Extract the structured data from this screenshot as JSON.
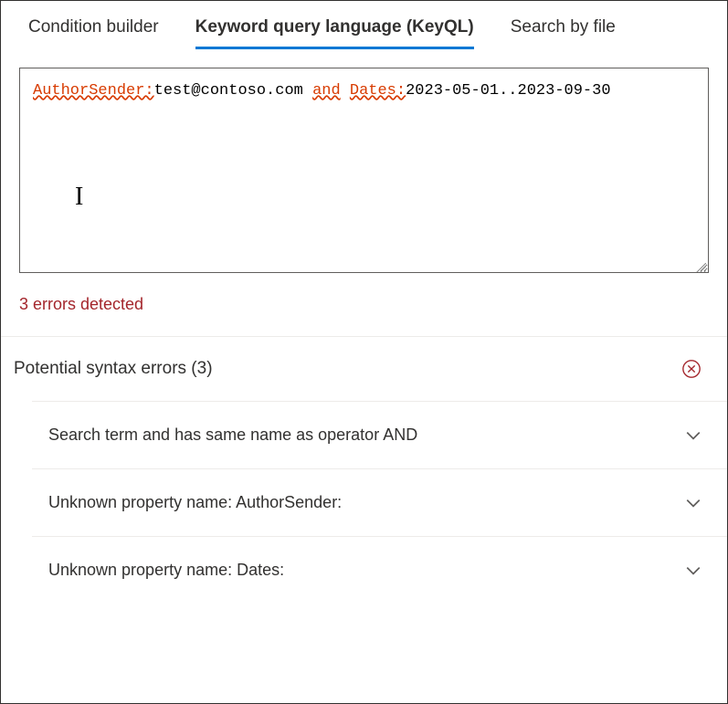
{
  "tabs": {
    "condition_builder": "Condition builder",
    "keyql": "Keyword query language (KeyQL)",
    "search_by_file": "Search by file"
  },
  "query": {
    "prop1": "AuthorSender:",
    "val1": "test@contoso.com",
    "op": "and",
    "prop2": "Dates:",
    "val2": "2023-05-01..2023-09-30"
  },
  "error_summary": "3 errors detected",
  "section": {
    "title": "Potential syntax errors (3)"
  },
  "errors": [
    {
      "message": "Search term and has same name as operator AND"
    },
    {
      "message": "Unknown property name: AuthorSender:"
    },
    {
      "message": "Unknown property name: Dates:"
    }
  ]
}
